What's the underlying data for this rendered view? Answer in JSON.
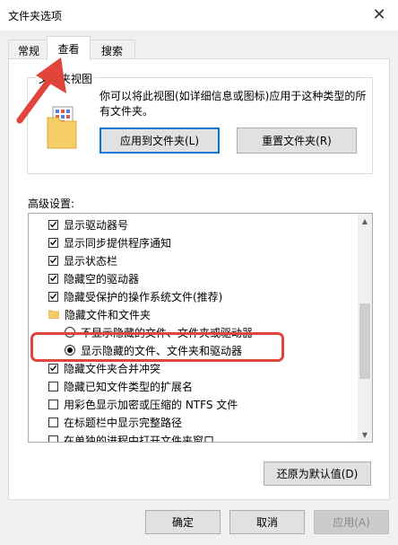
{
  "window": {
    "title": "文件夹选项"
  },
  "tabs": [
    {
      "label": "常规"
    },
    {
      "label": "查看"
    },
    {
      "label": "搜索"
    }
  ],
  "folder_view": {
    "group_label": "文件夹视图",
    "description": "你可以将此视图(如详细信息或图标)应用于这种类型的所有文件夹。",
    "apply_button": "应用到文件夹(L)",
    "reset_button": "重置文件夹(R)"
  },
  "advanced": {
    "label": "高级设置:",
    "items": [
      {
        "type": "checkbox",
        "checked": true,
        "label": "显示驱动器号"
      },
      {
        "type": "checkbox",
        "checked": true,
        "label": "显示同步提供程序通知"
      },
      {
        "type": "checkbox",
        "checked": true,
        "label": "显示状态栏"
      },
      {
        "type": "checkbox",
        "checked": true,
        "label": "隐藏空的驱动器"
      },
      {
        "type": "checkbox",
        "checked": true,
        "label": "隐藏受保护的操作系统文件(推荐)"
      },
      {
        "type": "folder",
        "label": "隐藏文件和文件夹"
      },
      {
        "type": "radio",
        "checked": false,
        "label": "不显示隐藏的文件、文件夹或驱动器"
      },
      {
        "type": "radio",
        "checked": true,
        "label": "显示隐藏的文件、文件夹和驱动器"
      },
      {
        "type": "checkbox",
        "checked": true,
        "label": "隐藏文件夹合并冲突"
      },
      {
        "type": "checkbox",
        "checked": false,
        "label": "隐藏已知文件类型的扩展名"
      },
      {
        "type": "checkbox",
        "checked": false,
        "label": "用彩色显示加密或压缩的 NTFS 文件"
      },
      {
        "type": "checkbox",
        "checked": false,
        "label": "在标题栏中显示完整路径"
      },
      {
        "type": "checkbox",
        "checked": false,
        "label": "在单独的进程中打开文件夹窗口"
      }
    ],
    "restore_button": "还原为默认值(D)"
  },
  "footer": {
    "ok": "确定",
    "cancel": "取消",
    "apply": "应用(A)"
  },
  "colors": {
    "highlight": "#e0443a",
    "focus_border": "#0078d7"
  }
}
